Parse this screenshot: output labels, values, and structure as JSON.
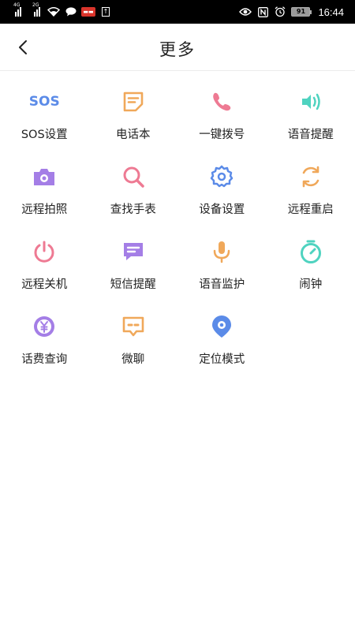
{
  "status_bar": {
    "network_1": "4G",
    "network_2": "2G",
    "battery": "91",
    "time": "16:44",
    "colors": {
      "background": "#000000",
      "text": "#ffffff"
    }
  },
  "header": {
    "title": "更多",
    "back_icon": "chevron-left-icon"
  },
  "grid": {
    "items": [
      {
        "label": "SOS设置",
        "icon": "sos-icon",
        "color": "#5b8be8",
        "icon_text": "SOS"
      },
      {
        "label": "电话本",
        "icon": "phonebook-icon",
        "color": "#f0a85a"
      },
      {
        "label": "一键拨号",
        "icon": "phone-icon",
        "color": "#ee7a93"
      },
      {
        "label": "语音提醒",
        "icon": "voice-reminder-icon",
        "color": "#4fd3c0"
      },
      {
        "label": "远程拍照",
        "icon": "camera-icon",
        "color": "#a47ee6"
      },
      {
        "label": "查找手表",
        "icon": "search-icon",
        "color": "#ee7a93"
      },
      {
        "label": "设备设置",
        "icon": "gear-icon",
        "color": "#5b8be8"
      },
      {
        "label": "远程重启",
        "icon": "restart-icon",
        "color": "#f0a85a"
      },
      {
        "label": "远程关机",
        "icon": "power-icon",
        "color": "#ee7a93"
      },
      {
        "label": "短信提醒",
        "icon": "message-icon",
        "color": "#a47ee6"
      },
      {
        "label": "语音监护",
        "icon": "microphone-icon",
        "color": "#f0a85a"
      },
      {
        "label": "闹钟",
        "icon": "alarm-clock-icon",
        "color": "#4fd3c0"
      },
      {
        "label": "话费查询",
        "icon": "yuan-coin-icon",
        "color": "#a47ee6"
      },
      {
        "label": "微聊",
        "icon": "chat-icon",
        "color": "#f0a85a"
      },
      {
        "label": "定位模式",
        "icon": "location-pin-icon",
        "color": "#5b8be8"
      }
    ]
  }
}
